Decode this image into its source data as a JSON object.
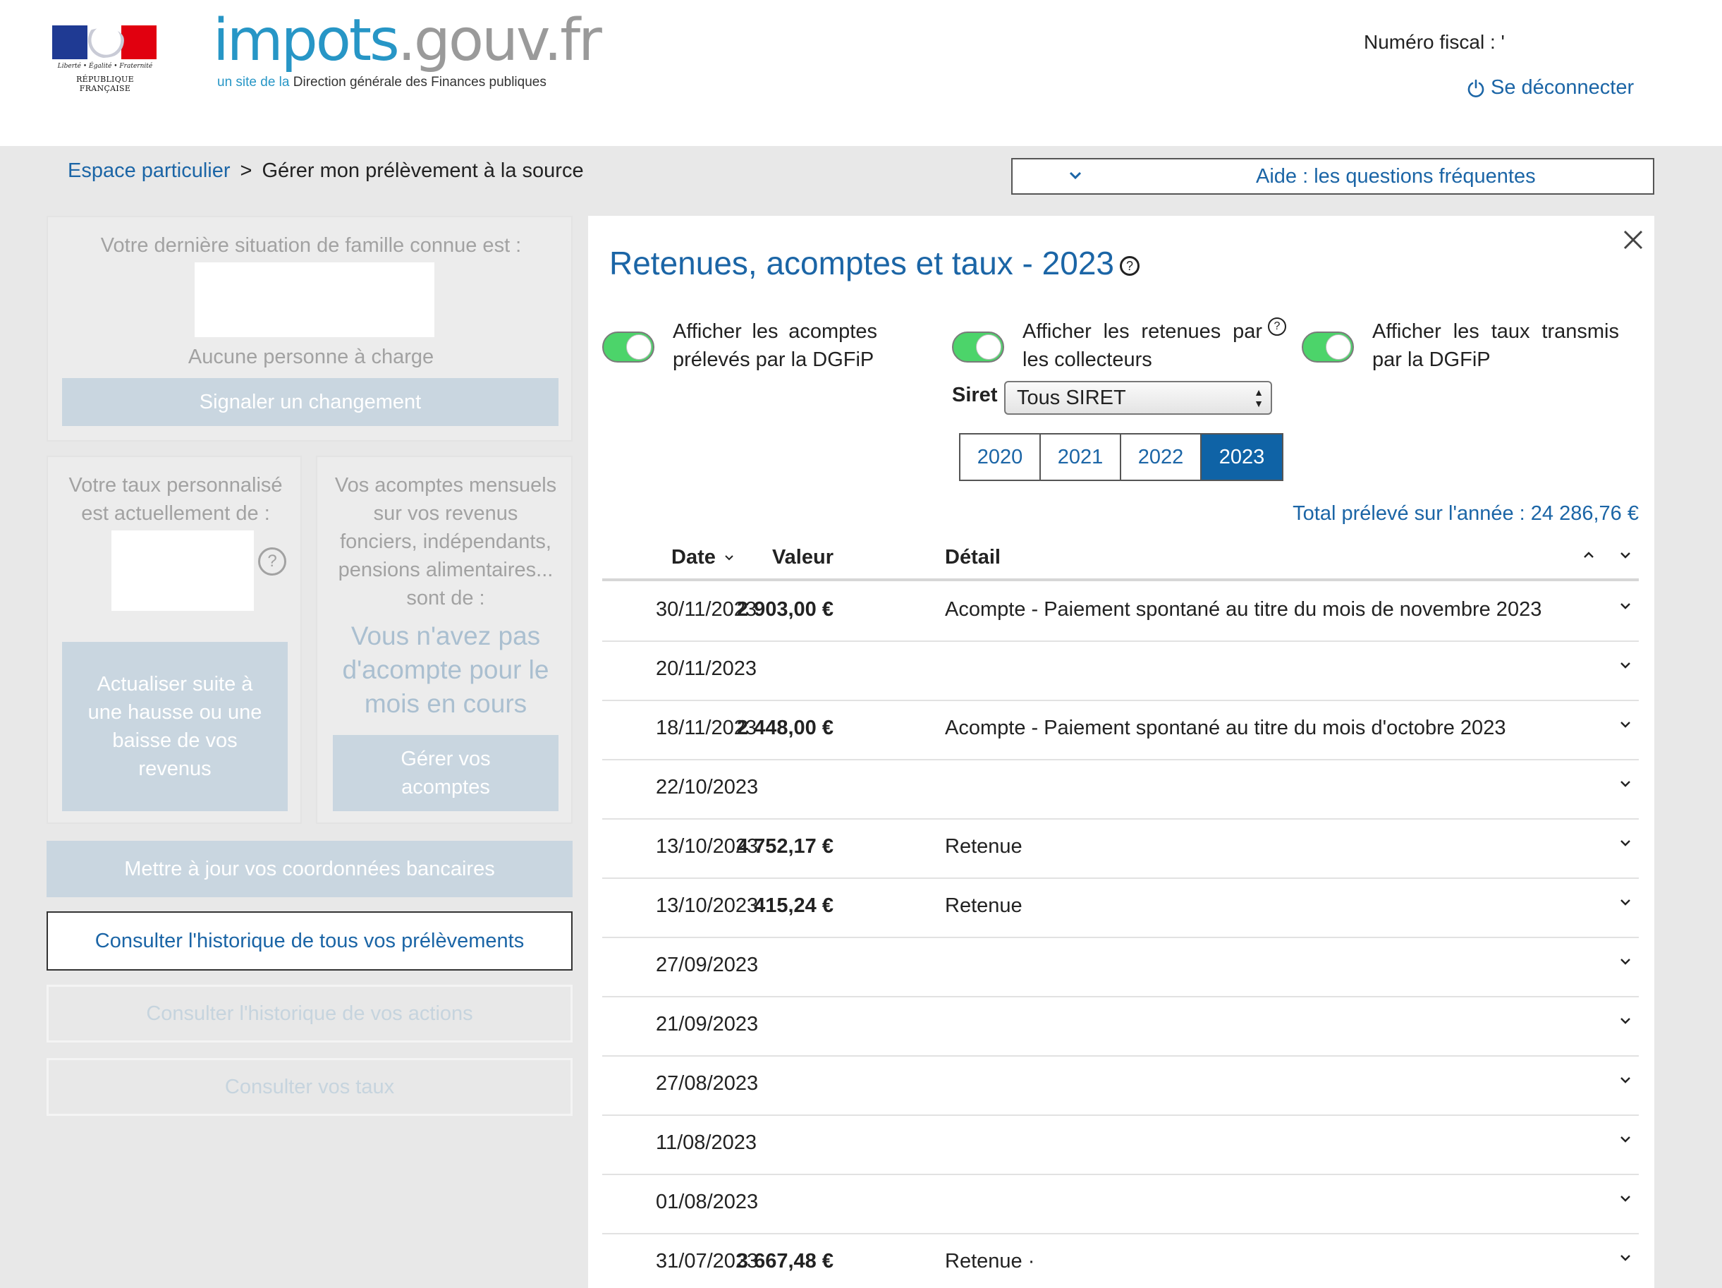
{
  "header": {
    "republique": "RÉPUBLIQUE FRANÇAISE",
    "devise": "Liberté • Égalité • Fraternité",
    "logo_part1": "impots",
    "logo_part2": ".gouv.fr",
    "tagline_prefix": "un site de la",
    "tagline_rest": "Direction générale des Finances publiques",
    "fiscal_label": "Numéro fiscal : '",
    "logout_label": "Se déconnecter"
  },
  "breadcrumb": {
    "home": "Espace particulier",
    "separator": ">",
    "current": "Gérer mon prélèvement à la source"
  },
  "faq": {
    "label": "Aide : les questions fréquentes"
  },
  "left": {
    "famille_title": "Votre dernière situation de famille connue est :",
    "famille_charge": "Aucune personne à charge",
    "famille_button": "Signaler un changement",
    "taux_title_1": "Votre taux personnalisé",
    "taux_title_2": "est actuellement de :",
    "taux_help": "?",
    "taux_button_1": "Actualiser suite à",
    "taux_button_2": "une hausse ou une",
    "taux_button_3": "baisse de vos",
    "taux_button_4": "revenus",
    "acomptes_title_1": "Vos acomptes mensuels",
    "acomptes_title_2": "sur vos revenus",
    "acomptes_title_3": "fonciers, indépendants,",
    "acomptes_title_4": "pensions alimentaires...",
    "acomptes_title_5": "sont de :",
    "acomptes_none_1": "Vous n'avez pas",
    "acomptes_none_2": "d'acompte pour le",
    "acomptes_none_3": "mois en cours",
    "acomptes_button_1": "Gérer vos",
    "acomptes_button_2": "acomptes",
    "bank_button": "Mettre à jour vos coordonnées bancaires",
    "history_button": "Consulter l'historique de tous vos prélèvements",
    "actions_button": "Consulter l'historique de vos actions",
    "taux_consult_button": "Consulter vos taux"
  },
  "panel": {
    "title": "Retenues, acomptes et taux - 2023",
    "title_help": "?",
    "toggle1_label": "Afficher les acomptes prélevés par la DGFiP",
    "toggle2_label": "Afficher les retenues par les collecteurs",
    "toggle2_help": "?",
    "toggle3_label": "Afficher les taux transmis par la DGFiP",
    "toggles_on": [
      true,
      true,
      true
    ],
    "siret_label": "Siret",
    "siret_value": "Tous SIRET",
    "years": [
      "2020",
      "2021",
      "2022",
      "2023"
    ],
    "active_year": "2023",
    "total": "Total prélevé sur l'année : 24 286,76 €",
    "columns": {
      "date": "Date",
      "valeur": "Valeur",
      "detail": "Détail"
    },
    "rows": [
      {
        "date": "30/11/2023",
        "valeur": "2 903,00 €",
        "detail": "Acompte - Paiement spontané au titre du mois de novembre 2023"
      },
      {
        "date": "20/11/2023",
        "valeur": "",
        "detail": ""
      },
      {
        "date": "18/11/2023",
        "valeur": "2 448,00 €",
        "detail": "Acompte - Paiement spontané au titre du mois d'octobre 2023"
      },
      {
        "date": "22/10/2023",
        "valeur": "",
        "detail": ""
      },
      {
        "date": "13/10/2023",
        "valeur": "4 752,17 €",
        "detail": "Retenue"
      },
      {
        "date": "13/10/2023",
        "valeur": "415,24 €",
        "detail": "Retenue"
      },
      {
        "date": "27/09/2023",
        "valeur": "",
        "detail": ""
      },
      {
        "date": "21/09/2023",
        "valeur": "",
        "detail": ""
      },
      {
        "date": "27/08/2023",
        "valeur": "",
        "detail": ""
      },
      {
        "date": "11/08/2023",
        "valeur": "",
        "detail": ""
      },
      {
        "date": "01/08/2023",
        "valeur": "",
        "detail": ""
      },
      {
        "date": "31/07/2023",
        "valeur": "3 667,48 €",
        "detail": "Retenue ·"
      }
    ]
  },
  "colors": {
    "brand_blue": "#1b65a6",
    "logo_blue": "#2796c6",
    "toggle_green": "#4cd46a",
    "active_year_bg": "#0f63a6",
    "disabled_button": "#c9d6e0"
  }
}
